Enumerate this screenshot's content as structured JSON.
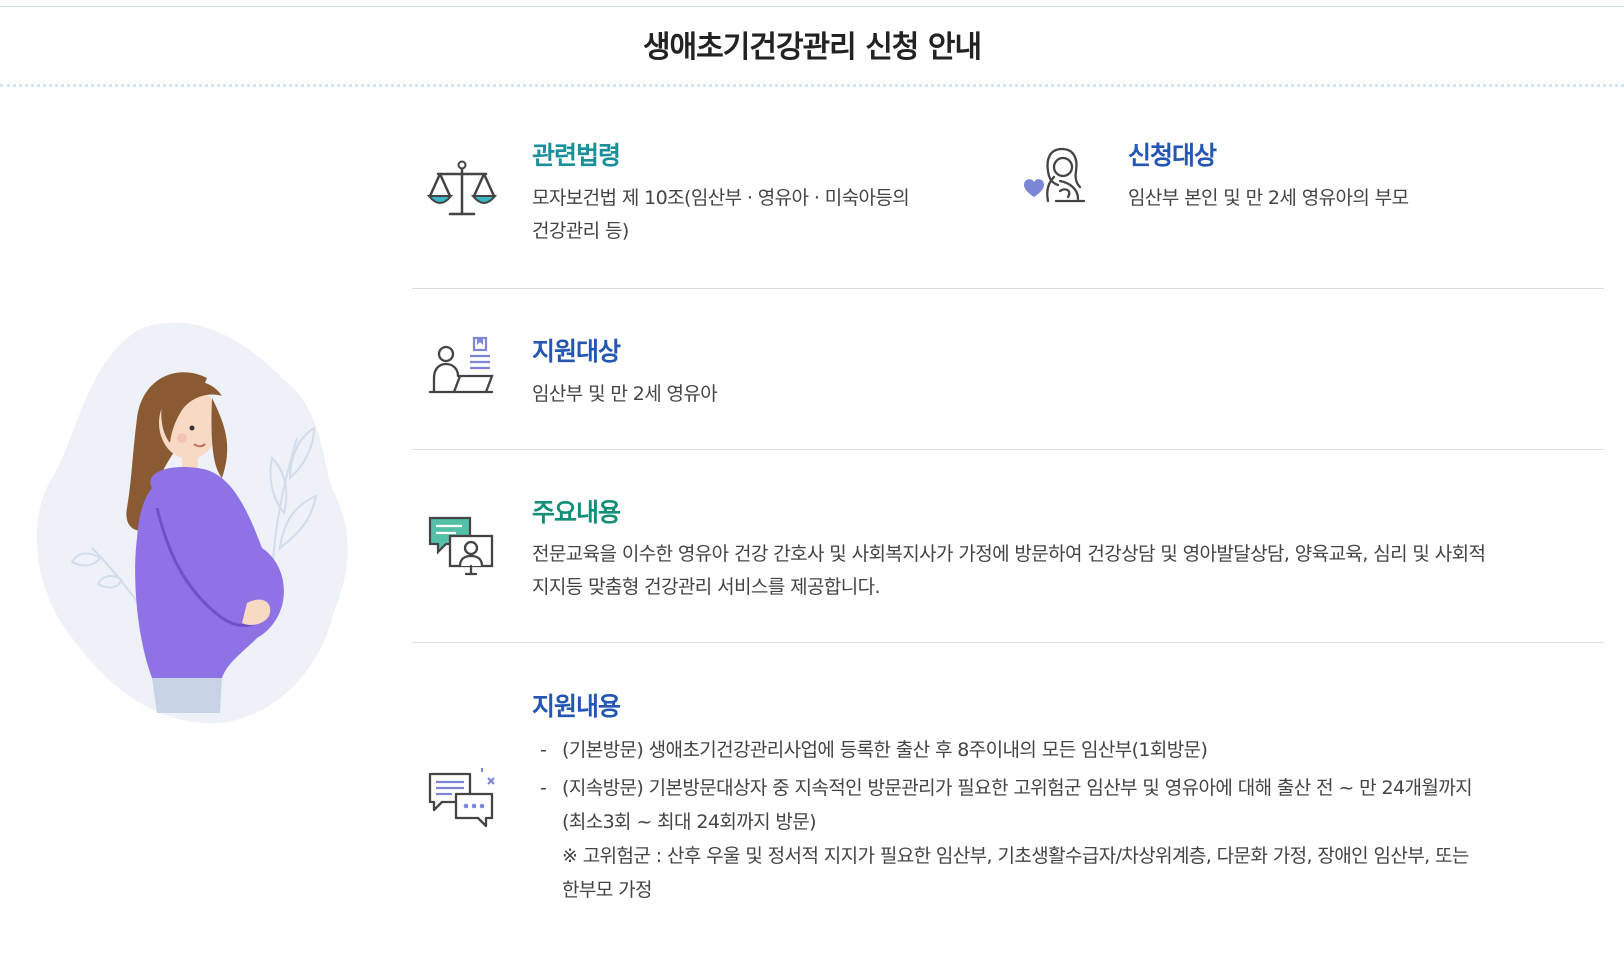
{
  "page": {
    "title": "생애초기건강관리 신청 안내"
  },
  "sections": {
    "law": {
      "icon": "scale-icon",
      "title": "관련법령",
      "lines": [
        "모자보건법 제 10조(임산부 · 영유아 · 미숙아등의",
        "건강관리 등)"
      ]
    },
    "applicant": {
      "icon": "mother-heart-icon",
      "title": "신청대상",
      "text": "임산부 본인 및 만 2세 영유아의 부모"
    },
    "support_target": {
      "icon": "person-document-icon",
      "title": "지원대상",
      "text": "임산부 및 만 2세 영유아"
    },
    "main_content": {
      "icon": "consultation-icon",
      "title": "주요내용",
      "lines": [
        "전문교육을 이수한 영유아 건강 간호사 및 사회복지사가 가정에 방문하여 건강상담 및 영아발달상담, 양육교육, 심리 및 사회적",
        "지지등 맞춤형 건강관리 서비스를 제공합니다."
      ]
    },
    "support_content": {
      "icon": "chat-bubbles-icon",
      "title": "지원내용",
      "items": [
        {
          "dash": "-",
          "lines": [
            "(기본방문) 생애초기건강관리사업에 등록한 출산 후 8주이내의 모든 임산부(1회방문)"
          ]
        },
        {
          "dash": "-",
          "lines": [
            "(지속방문) 기본방문대상자 중 지속적인 방문관리가 필요한 고위험군 임산부 및 영유아에 대해 출산 전 ~ 만 24개월까지",
            "(최소3회 ~ 최대 24회까지 방문)"
          ],
          "note_lines": [
            "※ 고위험군 : 산후 우울 및 정서적 지지가 필요한 임산부, 기초생활수급자/차상위계층, 다문화 가정, 장애인 임산부, 또는",
            "한부모 가정"
          ]
        }
      ]
    }
  },
  "colors": {
    "teal": "#1d8f9b",
    "blue": "#2456b3",
    "green": "#138f78",
    "illustration_purple": "#8f72e6",
    "illustration_blob": "#eef1f7"
  },
  "illustration": {
    "icon": "pregnant-woman-illustration"
  }
}
